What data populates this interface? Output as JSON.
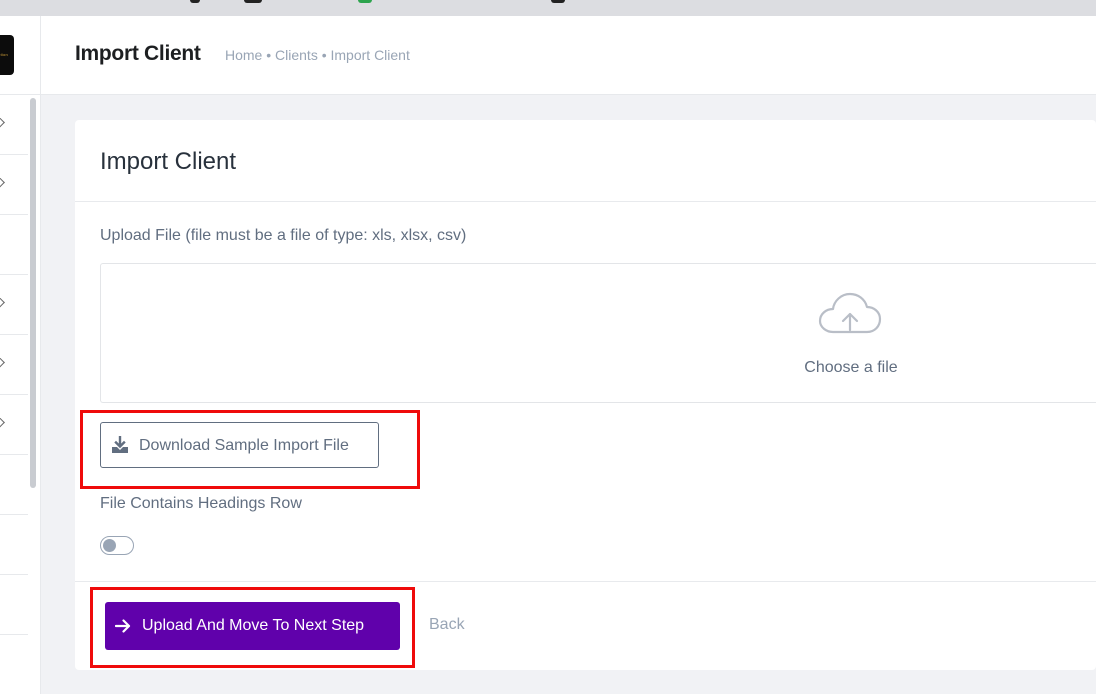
{
  "header": {
    "title": "Import Client",
    "breadcrumb": "Home • Clients • Import Client"
  },
  "card": {
    "title": "Import Client",
    "upload_label": "Upload File (file must be a file of type: xls, xlsx, csv)",
    "dropzone_text": "Choose a file",
    "download_button": "Download Sample Import File",
    "headings_label": "File Contains Headings Row",
    "headings_toggle_on": false,
    "upload_button": "Upload And Move To Next Step",
    "back_button": "Back"
  },
  "colors": {
    "primary": "#6001ab",
    "highlight": "#ef0b0b",
    "muted_text": "#616e80",
    "light_text": "#99a5b5"
  },
  "icons": {
    "dropzone": "cloud-upload-icon",
    "download": "download-icon",
    "upload": "arrow-right-icon",
    "sidebar": "chevron-right-icon"
  }
}
